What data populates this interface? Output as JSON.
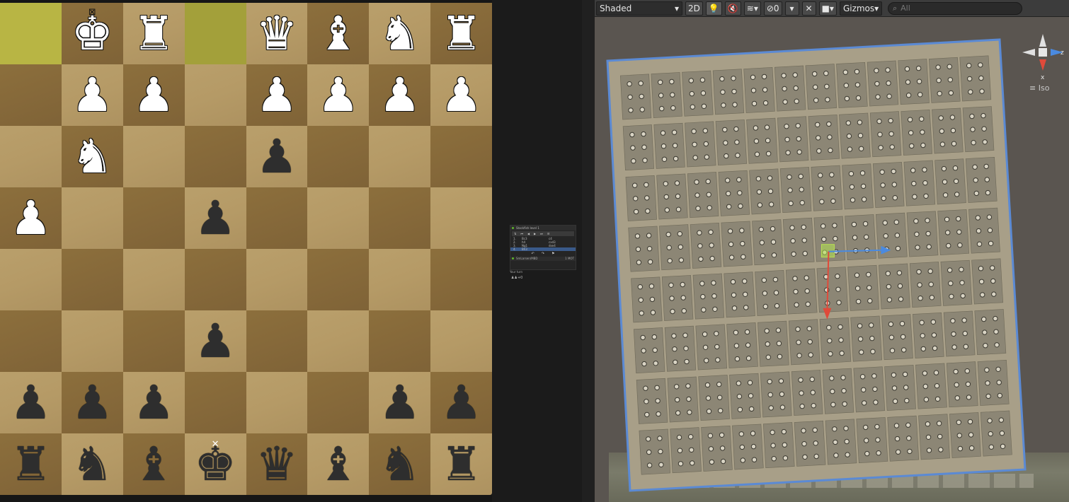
{
  "board": {
    "highlight_color": "#b8b544",
    "rows": [
      [
        {
          "p": "",
          "c": "",
          "hl": true
        },
        {
          "p": "king",
          "c": "w",
          "mark": "⊠"
        },
        {
          "p": "rook",
          "c": "w"
        },
        {
          "p": "",
          "c": "",
          "hl": true
        },
        {
          "p": "queen",
          "c": "w"
        },
        {
          "p": "bishop",
          "c": "w"
        },
        {
          "p": "knight",
          "c": "w"
        },
        {
          "p": "rook",
          "c": "w"
        }
      ],
      [
        {
          "p": "",
          "c": ""
        },
        {
          "p": "pawn",
          "c": "w"
        },
        {
          "p": "pawn",
          "c": "w"
        },
        {
          "p": "",
          "c": ""
        },
        {
          "p": "pawn",
          "c": "w"
        },
        {
          "p": "pawn",
          "c": "w"
        },
        {
          "p": "pawn",
          "c": "w"
        },
        {
          "p": "pawn",
          "c": "w"
        }
      ],
      [
        {
          "p": "",
          "c": ""
        },
        {
          "p": "knight",
          "c": "w"
        },
        {
          "p": "",
          "c": ""
        },
        {
          "p": "",
          "c": ""
        },
        {
          "p": "pawn",
          "c": "b"
        },
        {
          "p": "",
          "c": ""
        },
        {
          "p": "",
          "c": ""
        },
        {
          "p": "",
          "c": ""
        }
      ],
      [
        {
          "p": "pawn",
          "c": "w"
        },
        {
          "p": "",
          "c": ""
        },
        {
          "p": "",
          "c": ""
        },
        {
          "p": "pawn",
          "c": "b"
        },
        {
          "p": "",
          "c": ""
        },
        {
          "p": "",
          "c": ""
        },
        {
          "p": "",
          "c": ""
        },
        {
          "p": "",
          "c": ""
        }
      ],
      [
        {
          "p": "",
          "c": ""
        },
        {
          "p": "",
          "c": ""
        },
        {
          "p": "",
          "c": ""
        },
        {
          "p": "",
          "c": ""
        },
        {
          "p": "",
          "c": ""
        },
        {
          "p": "",
          "c": ""
        },
        {
          "p": "",
          "c": ""
        },
        {
          "p": "",
          "c": ""
        }
      ],
      [
        {
          "p": "",
          "c": ""
        },
        {
          "p": "",
          "c": ""
        },
        {
          "p": "",
          "c": ""
        },
        {
          "p": "pawn",
          "c": "b"
        },
        {
          "p": "",
          "c": ""
        },
        {
          "p": "",
          "c": ""
        },
        {
          "p": "",
          "c": ""
        },
        {
          "p": "",
          "c": ""
        }
      ],
      [
        {
          "p": "pawn",
          "c": "b"
        },
        {
          "p": "pawn",
          "c": "b"
        },
        {
          "p": "pawn",
          "c": "b"
        },
        {
          "p": "",
          "c": ""
        },
        {
          "p": "",
          "c": ""
        },
        {
          "p": "",
          "c": ""
        },
        {
          "p": "pawn",
          "c": "b"
        },
        {
          "p": "pawn",
          "c": "b"
        }
      ],
      [
        {
          "p": "rook",
          "c": "b"
        },
        {
          "p": "knight",
          "c": "b"
        },
        {
          "p": "bishop",
          "c": "b"
        },
        {
          "p": "king",
          "c": "b",
          "mark": "✕"
        },
        {
          "p": "queen",
          "c": "b"
        },
        {
          "p": "bishop",
          "c": "b"
        },
        {
          "p": "knight",
          "c": "b"
        },
        {
          "p": "rook",
          "c": "b"
        }
      ]
    ]
  },
  "mini_panel": {
    "title": "Stockfish level 1",
    "moves": [
      {
        "n": "1.",
        "w": "Bc3",
        "b": "c4"
      },
      {
        "n": "2.",
        "w": "h4",
        "b": "cxd3"
      },
      {
        "n": "3.",
        "w": "Ng1",
        "b": "dxe4"
      },
      {
        "n": "4.",
        "w": "Bh3",
        "b": ""
      }
    ],
    "footer_name": "SmLarsen/MBD",
    "footer_value": "1 MOT",
    "below_text": "Your turn"
  },
  "toolbar": {
    "shading_mode": "Shaded",
    "mode_2d": "2D",
    "hidden_count": "0",
    "gizmos_label": "Gizmos",
    "search_placeholder": "All"
  },
  "scene": {
    "tile_columns": 12,
    "tile_rows": 8,
    "selection_color": "#5b8ad4",
    "axis_x_color": "#e04a3a",
    "axis_z_color": "#4a8ae0"
  },
  "gizmo": {
    "label_z": "z",
    "label_x": "x",
    "view_label": "Iso"
  }
}
